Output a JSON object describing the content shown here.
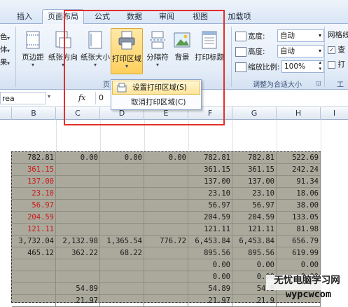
{
  "tabs": [
    "插入",
    "页面布局",
    "公式",
    "数据",
    "审阅",
    "视图",
    "加载项"
  ],
  "left_cut": [
    "色",
    "体",
    "果"
  ],
  "page_setup": {
    "buttons": [
      "页边距",
      "纸张方向",
      "纸张大小",
      "打印区域",
      "分隔符",
      "背景",
      "打印标题"
    ],
    "group_label": "页"
  },
  "scale": {
    "width_label": "宽度:",
    "width_value": "自动",
    "height_label": "高度:",
    "height_value": "自动",
    "zoom_label": "缩放比例:",
    "zoom_value": "100%",
    "group_label": "调整为合适大小"
  },
  "sheet_options": {
    "gridlines_label": "网格线",
    "view_label": "查",
    "print_label": "打",
    "group_label": "工"
  },
  "dropdown": {
    "set_area": "设置打印区域(S)",
    "clear_area": "取消打印区域(C)"
  },
  "formula_bar": {
    "name_box": "rea",
    "fx": "fx",
    "value": "0"
  },
  "columns": [
    "B",
    "C",
    "D",
    "E",
    "F",
    "G",
    "H",
    "I"
  ],
  "rows": [
    [
      "782.81",
      "0.00",
      "0.00",
      "0.00",
      "782.81",
      "782.81",
      "522.69"
    ],
    [
      "361.15",
      "",
      "",
      "",
      "361.15",
      "361.15",
      "242.24"
    ],
    [
      "137.00",
      "",
      "",
      "",
      "137.00",
      "137.00",
      "91.34"
    ],
    [
      "23.10",
      "",
      "",
      "",
      "23.10",
      "23.10",
      "18.06"
    ],
    [
      "56.97",
      "",
      "",
      "",
      "56.97",
      "56.97",
      "38.00"
    ],
    [
      "204.59",
      "",
      "",
      "",
      "204.59",
      "204.59",
      "133.05"
    ],
    [
      "121.11",
      "",
      "",
      "",
      "121.11",
      "121.11",
      "81.98"
    ],
    [
      "3,732.04",
      "2,132.98",
      "1,365.54",
      "776.72",
      "6,453.84",
      "6,453.84",
      "656.79"
    ],
    [
      "465.12",
      "362.22",
      "68.22",
      "",
      "895.56",
      "895.56",
      "619.99"
    ],
    [
      "",
      "",
      "",
      "",
      "0.00",
      "0.00",
      "0.00"
    ],
    [
      "",
      "",
      "",
      "",
      "0.00",
      "0.00",
      "0.00"
    ],
    [
      "",
      "54.89",
      "",
      "",
      "54.89",
      "54.8",
      ""
    ],
    [
      "",
      "21.97",
      "",
      "",
      "21.97",
      "21.9",
      ""
    ]
  ],
  "red_rows": [
    1,
    2,
    3,
    4,
    5,
    6
  ],
  "watermark": {
    "line1": "无忧电脑学习网",
    "line2": "wypcwcom"
  }
}
